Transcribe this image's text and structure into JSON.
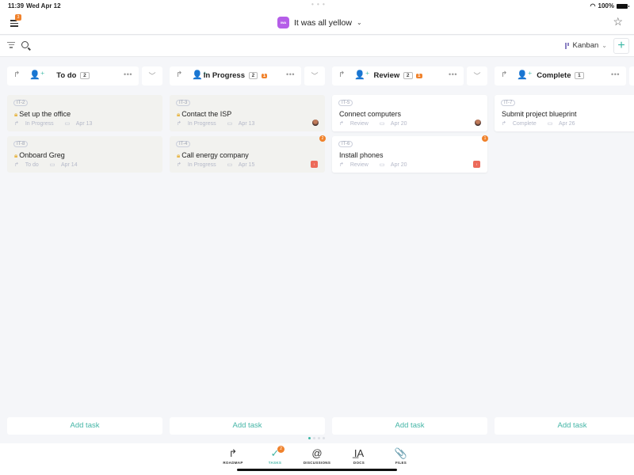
{
  "status_bar": {
    "time": "11:39",
    "date": "Wed Apr 12",
    "battery": "100%",
    "dots": "• • •"
  },
  "top_bar": {
    "menu_badge": "3",
    "project_logo_text": "IWA",
    "project_title": "It was all yellow",
    "project_chevron": "⌄",
    "star": "☆"
  },
  "toolbar": {
    "view_label": "Kanban",
    "view_chevron": "⌄",
    "add": "+"
  },
  "columns": [
    {
      "title": "To do",
      "count": "2",
      "alerts": null,
      "cards": [
        {
          "key": "IT-2",
          "title": "Set up the office",
          "locked": true,
          "status": "In Progress",
          "date": "Apr 13",
          "avatar": false,
          "priority": false,
          "comments": null
        },
        {
          "key": "IT-8",
          "title": "Onboard Greg",
          "locked": true,
          "status": "To do",
          "date": "Apr 14",
          "avatar": false,
          "priority": false,
          "comments": null
        }
      ]
    },
    {
      "title": "In Progress",
      "count": "2",
      "alerts": "1",
      "cards": [
        {
          "key": "IT-3",
          "title": "Contact the ISP",
          "locked": true,
          "status": "In Progress",
          "date": "Apr 13",
          "avatar": true,
          "priority": false,
          "comments": null
        },
        {
          "key": "IT-4",
          "title": "Call energy company",
          "locked": true,
          "status": "In Progress",
          "date": "Apr 15",
          "avatar": false,
          "priority": true,
          "comments": "2"
        }
      ]
    },
    {
      "title": "Review",
      "count": "2",
      "alerts": "1",
      "cards": [
        {
          "key": "IT-5",
          "title": "Connect computers",
          "locked": false,
          "status": "Review",
          "date": "Apr 20",
          "avatar": true,
          "priority": false,
          "comments": null
        },
        {
          "key": "IT-6",
          "title": "Install phones",
          "locked": false,
          "status": "Review",
          "date": "Apr 20",
          "avatar": false,
          "priority": true,
          "comments": "1"
        }
      ]
    },
    {
      "title": "Complete",
      "count": "1",
      "alerts": null,
      "cards": [
        {
          "key": "IT-7",
          "title": "Submit project blueprint",
          "locked": false,
          "status": "Complete",
          "date": "Apr 26",
          "avatar": true,
          "priority": false,
          "comments": null
        }
      ]
    }
  ],
  "add_task_label": "Add task",
  "pager": {
    "pages": 4,
    "current": 1
  },
  "tabs": [
    {
      "label": "ROADMAP",
      "icon": "↱",
      "active": false,
      "badge": null
    },
    {
      "label": "TASKS",
      "icon": "✓",
      "active": true,
      "badge": "2"
    },
    {
      "label": "DISCUSSIONS",
      "icon": "@",
      "active": false,
      "badge": null
    },
    {
      "label": "DOCS",
      "icon": "I̲A",
      "active": false,
      "badge": null
    },
    {
      "label": "FILES",
      "icon": "📎",
      "active": false,
      "badge": null
    }
  ],
  "colors": {
    "accent": "#3cb8a5",
    "alert": "#f0822c",
    "priority": "#ec6a5a",
    "project_logo": "#b55ee8"
  }
}
